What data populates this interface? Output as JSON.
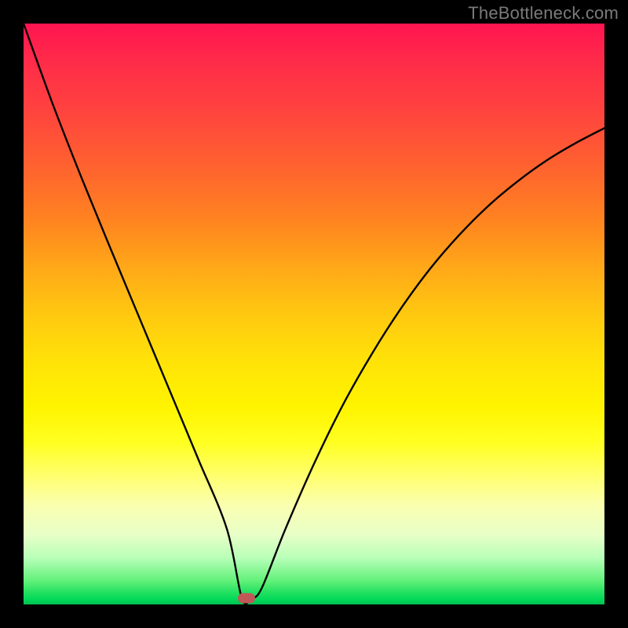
{
  "watermark": "TheBottleneck.com",
  "chart_data": {
    "type": "line",
    "title": "",
    "xlabel": "",
    "ylabel": "",
    "x": [
      0.0,
      0.05,
      0.1,
      0.15,
      0.2,
      0.25,
      0.3,
      0.35,
      0.376,
      0.392,
      0.41,
      0.45,
      0.5,
      0.55,
      0.6,
      0.65,
      0.7,
      0.75,
      0.8,
      0.85,
      0.9,
      0.95,
      1.0
    ],
    "values": [
      1.0,
      0.862,
      0.734,
      0.612,
      0.492,
      0.372,
      0.252,
      0.13,
      0.01,
      0.01,
      0.028,
      0.128,
      0.242,
      0.344,
      0.432,
      0.51,
      0.578,
      0.636,
      0.686,
      0.728,
      0.764,
      0.794,
      0.82
    ],
    "minimum_marker": {
      "x": 0.384,
      "y": 0.011
    },
    "ylim": [
      0,
      1
    ],
    "xlim": [
      0,
      1
    ],
    "background_gradient_top": "#ff1450",
    "background_gradient_bottom": "#00c050",
    "curve_color": "#000000",
    "marker_color": "#c05858"
  }
}
